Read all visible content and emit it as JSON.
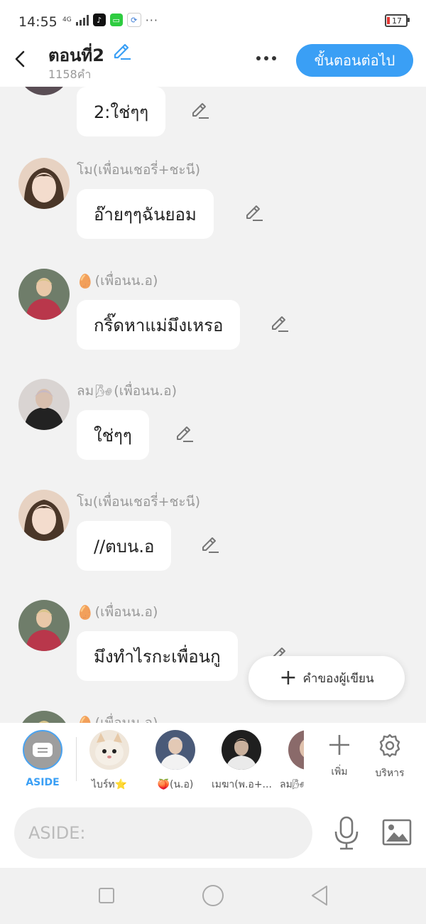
{
  "status_bar": {
    "time": "14:55",
    "network": "4G",
    "battery": "17",
    "more": "···"
  },
  "header": {
    "title": "ตอนที่2",
    "word_count": "1158คำ",
    "next_label": "ขั้นตอนต่อไป"
  },
  "messages": [
    {
      "sender": "",
      "text": "2:ใช่ๆๆ",
      "avatar_color": "#5a4e55"
    },
    {
      "sender": "โม(เพื่อนเชอรี่+ชะนี)",
      "text": "อ๊ายๆๆฉันยอม",
      "avatar_color": "#c9a58c"
    },
    {
      "sender": "(เพื่อนน.อ)",
      "emoji": "🥚",
      "text": "กริ๊ดหาแม่มึงเหรอ",
      "avatar_color": "#b9374b"
    },
    {
      "sender": "ลม",
      "emoji": "🌬",
      "sender_suffix": "(เพื่อนน.อ)",
      "text": "ใช่ๆๆ",
      "avatar_color": "#3b3b3b"
    },
    {
      "sender": "โม(เพื่อนเชอรี่+ชะนี)",
      "text": "//ตบน.อ",
      "avatar_color": "#c9a58c"
    },
    {
      "sender": "(เพื่อนน.อ)",
      "emoji": "🥚",
      "text": "มึงทำไรกะเพื่อนกู",
      "avatar_color": "#b9374b"
    },
    {
      "sender": "(เพื่อนน.อ)",
      "emoji": "🥚",
      "text": "",
      "avatar_color": "#b9374b"
    }
  ],
  "float_button": {
    "label": "คำของผู้เขียน",
    "icon": "plus-icon"
  },
  "characters": [
    {
      "name": "ASIDE",
      "color": "#9e9e9e"
    },
    {
      "name": "ไบร์ท⭐",
      "color": "#e8dcc8"
    },
    {
      "name": "🍑(น.อ)",
      "color": "#4a5a78"
    },
    {
      "name": "เมฆา(พ.อ+...",
      "color": "#1f1f1f"
    },
    {
      "name": "ลม🌬",
      "color": "#8a6a6a"
    }
  ],
  "tools": {
    "add_label": "เพิ่ม",
    "manage_label": "บริหาร"
  },
  "input": {
    "placeholder": "ASIDE:"
  }
}
